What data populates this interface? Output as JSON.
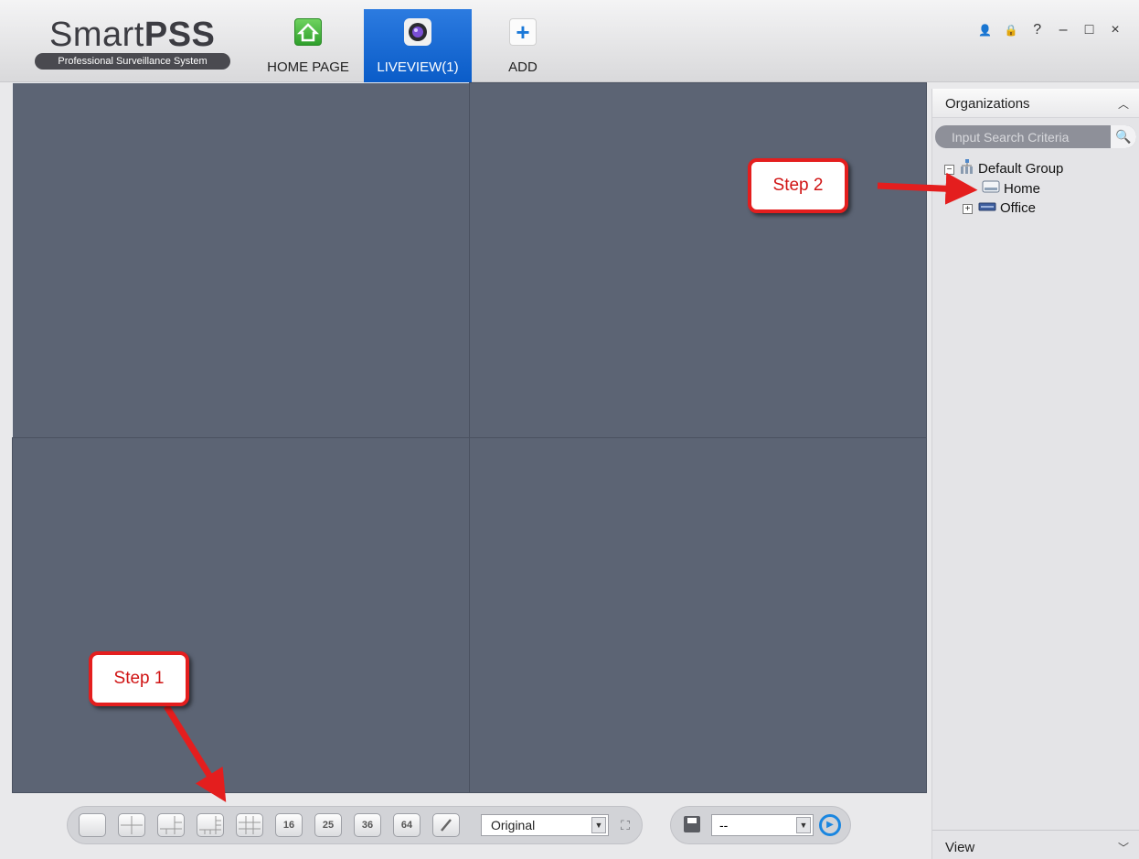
{
  "app": {
    "logo_name_light": "Smart",
    "logo_name_bold": "PSS",
    "logo_tagline": "Professional Surveillance System"
  },
  "nav": {
    "tabs": [
      {
        "label": "HOME PAGE",
        "icon": "home-icon",
        "active": false
      },
      {
        "label": "LIVEVIEW(1)",
        "icon": "camera-icon",
        "active": true
      },
      {
        "label": "ADD",
        "icon": "plus-icon",
        "active": false
      }
    ]
  },
  "window_controls": {
    "user_icon": "👤",
    "lock_icon": "🔒",
    "help": "?",
    "minimize": "–",
    "maximize": "□",
    "close": "×"
  },
  "video_grid": {
    "layout": "2x2",
    "selected_pane": 0
  },
  "toolbar": {
    "layouts": [
      "1",
      "4",
      "6",
      "8",
      "9",
      "16",
      "25",
      "36",
      "64",
      "custom"
    ],
    "ratio_value": "Original",
    "view_value": "--"
  },
  "organizations": {
    "title": "Organizations",
    "search_placeholder": "Input Search Criteria",
    "tree": {
      "root": "Default Group",
      "children": [
        "Home",
        "Office"
      ]
    }
  },
  "view_panel": {
    "title": "View"
  },
  "annotations": {
    "step1": "Step 1",
    "step2": "Step 2"
  },
  "colors": {
    "grid_bg": "#5c6474",
    "active_tab": "#0a5cc8",
    "callout_red": "#e41e1e"
  }
}
